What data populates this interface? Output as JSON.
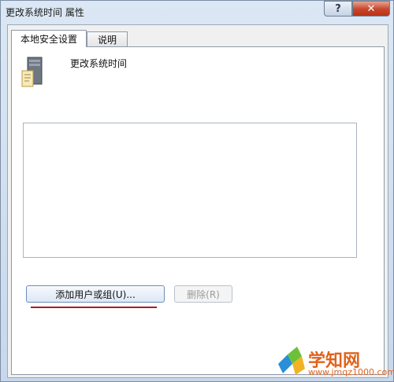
{
  "window": {
    "title": "更改系统时间 属性",
    "help_glyph": "?",
    "close_glyph": "✕"
  },
  "tabs": [
    {
      "label": "本地安全设置"
    },
    {
      "label": "说明"
    }
  ],
  "policy": {
    "name": "更改系统时间",
    "icon": "server-policy-icon"
  },
  "members_list": [],
  "buttons": {
    "add_label": "添加用户或组(U)...",
    "remove_label": "删除(R)"
  },
  "watermark": {
    "name": "学知网",
    "url": "www.jmqz1000.com"
  },
  "colors": {
    "close_button": "#c6452c",
    "annotation_underline": "#b0191f",
    "watermark": "#e0631d"
  }
}
